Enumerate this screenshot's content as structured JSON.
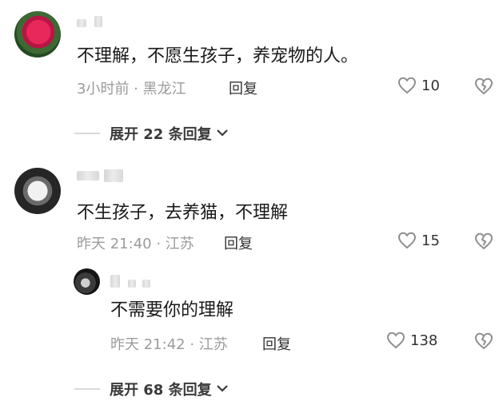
{
  "comments": [
    {
      "text": "不理解，不愿生孩子，养宠物的人。",
      "meta": "3小时前 · 黑龙江",
      "reply_label": "回复",
      "likes": "10",
      "expand_label": "展开 22 条回复"
    },
    {
      "text": "不生孩子，去养猫，不理解",
      "meta": "昨天 21:40 · 江苏",
      "reply_label": "回复",
      "likes": "15",
      "replies": [
        {
          "text": "不需要你的理解",
          "meta": "昨天 21:42 · 江苏",
          "reply_label": "回复",
          "likes": "138"
        }
      ],
      "expand_label": "展开 68 条回复"
    }
  ],
  "icons": {
    "like": "heart-icon",
    "dislike": "broken-heart-icon",
    "expand": "chevron-down-icon"
  }
}
